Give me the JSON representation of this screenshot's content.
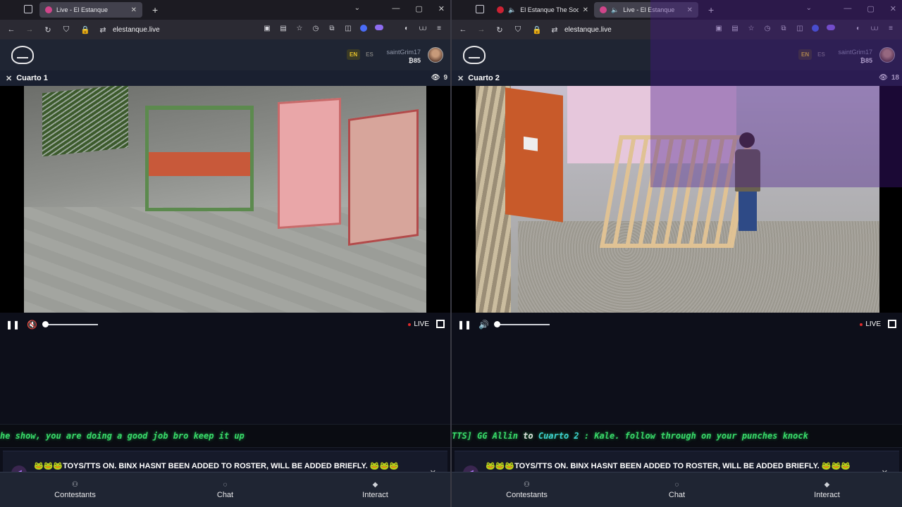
{
  "left": {
    "tabs": [
      {
        "title": "Live - El Estanque"
      }
    ],
    "url": "elestanque.live",
    "lang": {
      "en": "EN",
      "es": "ES"
    },
    "user": {
      "name": "saintGrim17",
      "coins": "₿85"
    },
    "room": {
      "name": "Cuarto 1",
      "viewers": "9"
    },
    "live_label": "LIVE",
    "ticker": {
      "segments": [
        {
          "text": "he show, you are doing a good job bro keep it up",
          "tone": "green"
        }
      ]
    },
    "announcement": "🐸🐸🐸TOYS/TTS ON. BINX HASNT BEEN ADDED TO ROSTER, WILL BE ADDED BRIEFLY. 🐸🐸🐸 WILL BE A FUN NIGHT, SOME SKIN WILL DEFINETLY BE SHOWN TONIGHT! 😳😳",
    "nav": [
      {
        "label": "Contestants",
        "icon": "users-icon"
      },
      {
        "label": "Chat",
        "icon": "chat-icon"
      },
      {
        "label": "Interact",
        "icon": "interact-icon"
      }
    ]
  },
  "right": {
    "tabs": [
      {
        "title": "El Estanque The Social Expe"
      },
      {
        "title": "Live - El Estanque"
      }
    ],
    "url": "elestanque.live",
    "lang": {
      "en": "EN",
      "es": "ES"
    },
    "user": {
      "name": "saintGrim17",
      "coins": "₿85"
    },
    "room": {
      "name": "Cuarto 2",
      "viewers": "18"
    },
    "live_label": "LIVE",
    "ticker": {
      "segments": [
        {
          "text": "TTS] GG Allin ",
          "tone": "green"
        },
        {
          "text": "to ",
          "tone": "white"
        },
        {
          "text": "Cuarto 2",
          "tone": "cyan"
        },
        {
          "text": " : Kale. follow through on your punches knock",
          "tone": "green"
        }
      ]
    },
    "announcement": "🐸🐸🐸TOYS/TTS ON. BINX HASNT BEEN ADDED TO ROSTER, WILL BE ADDED BRIEFLY. 🐸🐸🐸 WILL BE A FUN NIGHT, SOME SKIN WILL DEFINETLY BE SHOWN TONIGHT! 😳😳",
    "nav": [
      {
        "label": "Contestants",
        "icon": "users-icon"
      },
      {
        "label": "Chat",
        "icon": "chat-icon"
      },
      {
        "label": "Interact",
        "icon": "interact-icon"
      }
    ]
  },
  "colors": {
    "accent_green": "#39d96a",
    "accent_cyan": "#3fd2d6",
    "live_red": "#e02a2a",
    "lang_active": "#e6c12a"
  }
}
